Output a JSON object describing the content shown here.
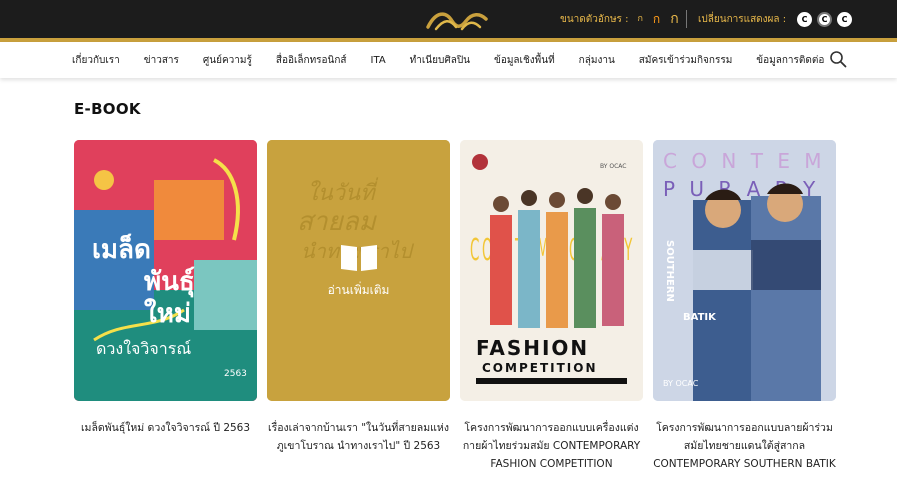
{
  "topbar": {
    "font_size_label": "ขนาดตัวอักษร :",
    "font_sizes": [
      "ก",
      "ก",
      "ก"
    ],
    "display_label": "เปลี่ยนการแสดงผล :",
    "display_modes": [
      "C",
      "C",
      "C"
    ],
    "logo_icon": "logo-icon",
    "accent_color": "#c9a03d"
  },
  "nav": {
    "items": [
      "เกี่ยวกับเรา",
      "ข่าวสาร",
      "ศูนย์ความรู้",
      "สื่ออิเล็กทรอนิกส์",
      "ITA",
      "ทำเนียบศิลปิน",
      "ข้อมูลเชิงพื้นที่",
      "กลุ่มงาน",
      "สมัครเข้าร่วมกิจกรรม",
      "ข้อมูลการติดต่อ"
    ],
    "search_icon": "search-icon"
  },
  "section": {
    "title": "E-BOOK"
  },
  "books": [
    {
      "caption": "เมล็ดพันธุ์ใหม่ ดวงใจวิจารณ์ ปี 2563",
      "cover_text": {
        "line1": "เมล็ด",
        "line2": "พันธุ์",
        "line3": "ใหม่",
        "line4": "ดวงใจวิจารณ์",
        "year": "2563"
      }
    },
    {
      "caption": "เรื่องเล่าจากบ้านเรา \"ในวันที่สายลมแห่งภูเขาโบราณ นำทางเราไป\" ปี 2563",
      "overlay_label": "อ่านเพิ่มเติม",
      "cover_text": {
        "line1": "ในวันที่",
        "line2": "สายลม",
        "line3": "นำทางเราไป"
      }
    },
    {
      "caption": "โครงการพัฒนาการออกแบบเครื่องแต่งกายผ้าไทยร่วมสมัย CONTEMPORARY FASHION COMPETITION",
      "cover_text": {
        "by": "BY OCAC",
        "letters": "CON TEM POR ARY",
        "fashion": "FASHION",
        "competition": "COMPETITION"
      }
    },
    {
      "caption": "โครงการพัฒนาการออกแบบลายผ้าร่วมสมัยไทยชายแดนใต้สู่สากล CONTEMPORARY SOUTHERN BATIK",
      "cover_text": {
        "row1": "C O N T E M",
        "row2": "P U R A R Y",
        "southern": "SOUTHERN",
        "batik": "BATIK",
        "by": "BY OCAC"
      }
    }
  ]
}
